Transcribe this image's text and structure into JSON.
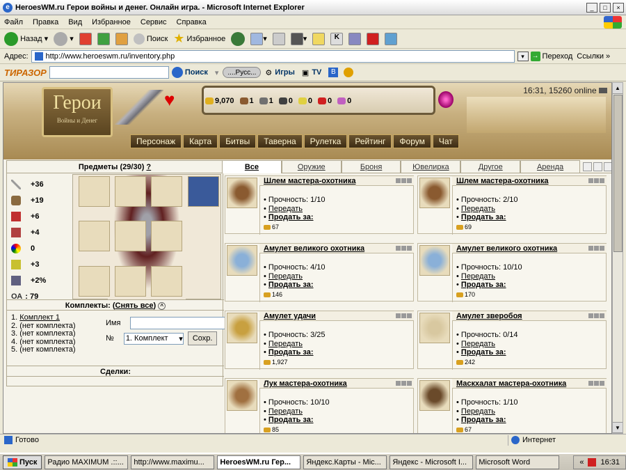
{
  "window": {
    "title": "HeroesWM.ru Герои войны и денег. Онлайн игра. - Microsoft Internet Explorer"
  },
  "menu": [
    "Файл",
    "Правка",
    "Вид",
    "Избранное",
    "Сервис",
    "Справка"
  ],
  "toolbar": {
    "back": "Назад",
    "search": "Поиск",
    "favorites": "Избранное"
  },
  "address": {
    "label": "Адрес:",
    "url": "http://www.heroeswm.ru/inventory.php",
    "go": "Переход",
    "links": "Ссылки"
  },
  "toolbar2": {
    "logo": "ТИРАЗОР",
    "search_btn": "Поиск",
    "lang": "....Русс...",
    "games": "Игры",
    "tv": "TV"
  },
  "game": {
    "resources": [
      "9,070",
      "1",
      "1",
      "0",
      "0",
      "0",
      "0"
    ],
    "online": "16:31, 15260 online",
    "nav": [
      "Персонаж",
      "Карта",
      "Битвы",
      "Таверна",
      "Рулетка",
      "Рейтинг",
      "Форум",
      "Чат"
    ],
    "logo_title": "Герои",
    "logo_sub": "Войны и Денег"
  },
  "left": {
    "header": "Предметы (29/30)",
    "help": "?",
    "stats": [
      "+36",
      "+19",
      "+6",
      "+4",
      "0",
      "+3",
      "+2%"
    ],
    "oa_label": "ОА",
    "oa_value": "79",
    "kits_label": "Комплекты:",
    "kits_remove": "Снять все",
    "kits": [
      {
        "num": "1.",
        "name": "Комплект 1"
      },
      {
        "num": "2.",
        "name": "(нет комплекта)"
      },
      {
        "num": "3.",
        "name": "(нет комплекта)"
      },
      {
        "num": "4.",
        "name": "(нет комплекта)"
      },
      {
        "num": "5.",
        "name": "(нет комплекта)"
      }
    ],
    "name_label": "Имя",
    "num_label": "№",
    "select_value": "1. Комплект",
    "save_btn": "Сохр.",
    "deals": "Сделки:"
  },
  "tabs": [
    "Все",
    "Оружие",
    "Броня",
    "Ювелирка",
    "Другое",
    "Аренда"
  ],
  "items": [
    {
      "name": "Шлем мастера-охотника",
      "dur": "Прочность: 1/10",
      "price": "67",
      "color": "#8a5a30"
    },
    {
      "name": "Шлем мастера-охотника",
      "dur": "Прочность: 2/10",
      "price": "69",
      "color": "#8a5a30"
    },
    {
      "name": "Амулет великого охотника",
      "dur": "Прочность: 4/10",
      "price": "146",
      "color": "#8ab0d8"
    },
    {
      "name": "Амулет великого охотника",
      "dur": "Прочность: 10/10",
      "price": "170",
      "color": "#8ab0d8"
    },
    {
      "name": "Амулет удачи",
      "dur": "Прочность: 3/25",
      "price": "1,927",
      "color": "#c8a040"
    },
    {
      "name": "Амулет зверобоя",
      "dur": "Прочность: 0/14",
      "price": "242",
      "color": "#d8c8a0"
    },
    {
      "name": "Лук мастера-охотника",
      "dur": "Прочность: 10/10",
      "price": "85",
      "color": "#a07040"
    },
    {
      "name": "Маскхалат мастера-охотника",
      "dur": "Прочность: 1/10",
      "price": "67",
      "color": "#6a4a2a"
    }
  ],
  "item_labels": {
    "transfer": "Передать",
    "sell": "Продать за:"
  },
  "status": {
    "left": "Готово",
    "zone": "Интернет"
  },
  "taskbar": {
    "start": "Пуск",
    "tasks": [
      "Радио MAXIMUM .::...",
      "http://www.maximu...",
      "HeroesWM.ru Гер...",
      "Яндекс.Карты - Mic...",
      "Яндекс - Microsoft I...",
      "Microsoft Word"
    ],
    "clock": "16:31"
  }
}
